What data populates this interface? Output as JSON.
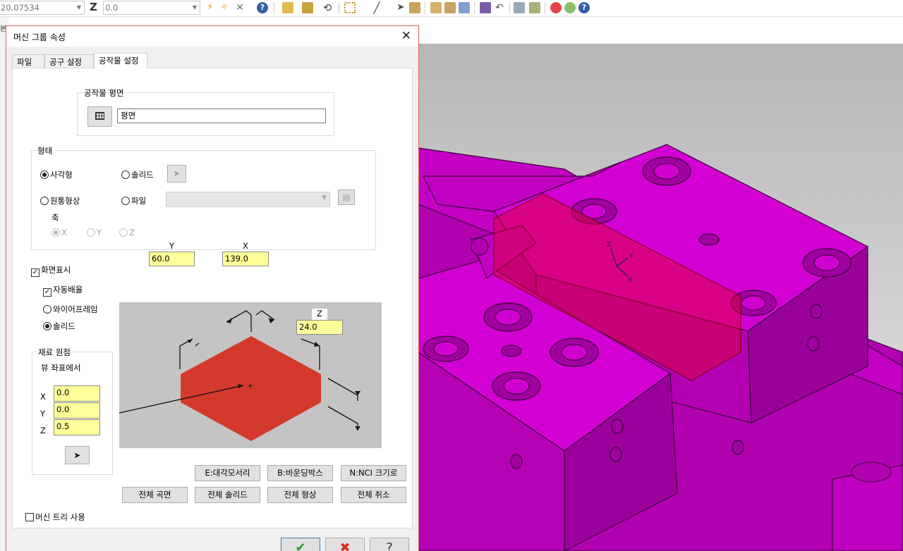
{
  "toolbar": {
    "coord_value": "20.07534",
    "z_label": "Z",
    "z_value": "0.0"
  },
  "left_strip_text": "본",
  "dialog": {
    "title": "머신 그룹 속성",
    "close": "✕",
    "tabs": [
      {
        "label": "파일"
      },
      {
        "label": "공구 설정"
      },
      {
        "label": "공작물 설정"
      }
    ],
    "stock_plane": {
      "group_title": "공작물 평면",
      "plane_value": "평면"
    },
    "shape": {
      "group_title": "형태",
      "rectangle": "사각형",
      "solid": "솔리드",
      "cylinder": "원통형상",
      "file": "파일",
      "axis_label": "축",
      "axis_x": "X",
      "axis_y": "Y",
      "axis_z": "Z"
    },
    "display": {
      "show_label": "화면표시",
      "auto_fit": "자동배율",
      "wireframe": "와이어프레임",
      "solid": "솔리드"
    },
    "dims": {
      "y_label": "Y",
      "x_label": "X",
      "z_label": "Z",
      "y_value": "60.0",
      "x_value": "139.0",
      "z_value": "24.0"
    },
    "origin": {
      "group_title": "재료 원점",
      "subtitle": "뷰 좌표에서",
      "x_label": "X",
      "y_label": "Y",
      "z_label": "Z",
      "x_value": "0.0",
      "y_value": "0.0",
      "z_value": "0.5"
    },
    "buttons": {
      "corner": "E:대각모서리",
      "bounding": "B:바운딩박스",
      "nci": "N:NCI 크기로",
      "all_surfaces": "전체 곡면",
      "all_solids": "전체 솔리드",
      "all_entities": "전체 형상",
      "unselect_all": "전체 취소"
    },
    "machine_tree": "머신 트리 사용",
    "footer": {
      "ok": "✔",
      "cancel": "✖",
      "help": "?"
    }
  },
  "colors": {
    "part": "#cc00cc",
    "stock_preview": "#d63a2c",
    "dim_input_bg": "#ffff99"
  }
}
